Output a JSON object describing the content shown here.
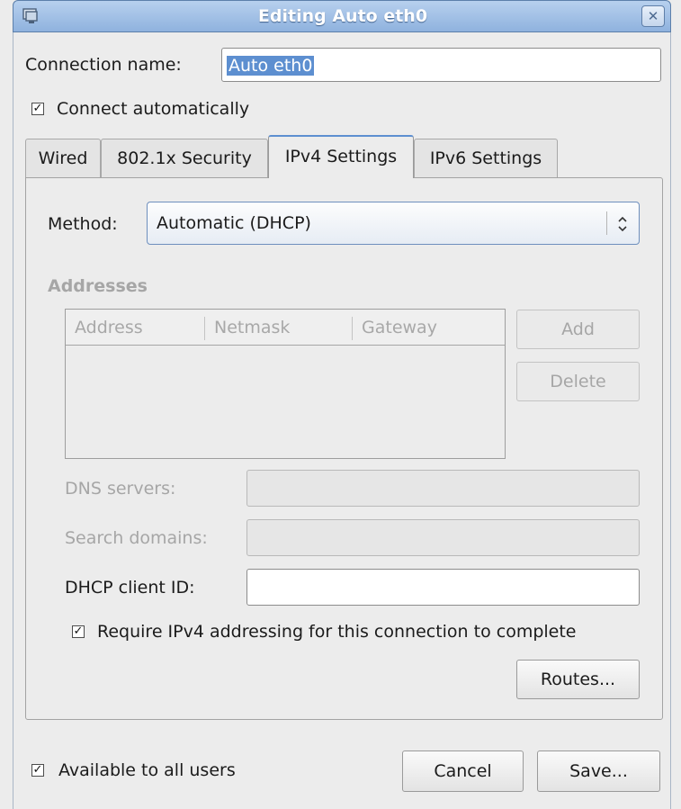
{
  "window": {
    "title": "Editing Auto eth0",
    "close_glyph": "✕"
  },
  "connection": {
    "name_label": "Connection name:",
    "name_value": "Auto eth0",
    "connect_auto_label": "Connect automatically",
    "connect_auto_checked": true
  },
  "tabs": [
    {
      "label": "Wired",
      "active": false
    },
    {
      "label": "802.1x Security",
      "active": false
    },
    {
      "label": "IPv4 Settings",
      "active": true
    },
    {
      "label": "IPv6 Settings",
      "active": false
    }
  ],
  "ipv4": {
    "method_label": "Method:",
    "method_value": "Automatic (DHCP)",
    "addresses_heading": "Addresses",
    "table_columns": [
      "Address",
      "Netmask",
      "Gateway"
    ],
    "add_label": "Add",
    "delete_label": "Delete",
    "dns_label": "DNS servers:",
    "dns_value": "",
    "search_label": "Search domains:",
    "search_value": "",
    "dhcp_id_label": "DHCP client ID:",
    "dhcp_id_value": "",
    "require_label": "Require IPv4 addressing for this connection to complete",
    "require_checked": true,
    "routes_label": "Routes..."
  },
  "footer": {
    "all_users_label": "Available to all users",
    "all_users_checked": true,
    "cancel_label": "Cancel",
    "save_label": "Save..."
  },
  "icons": {
    "check": "✓",
    "combo_arrows": "⌃⌄"
  },
  "colors": {
    "titlebar": "#8fb2de",
    "selection": "#5d8fd0",
    "disabled_text": "#a6a6a6"
  }
}
